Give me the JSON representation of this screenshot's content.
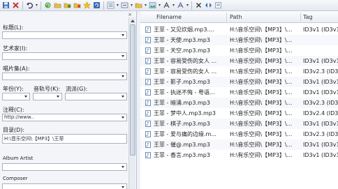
{
  "toolbar": {
    "icons": [
      "save-icon",
      "delete-icon",
      "undo-icon",
      "refresh-icon",
      "open-folder-icon",
      "folder-add-icon",
      "folder-star-icon",
      "star-icon",
      "reload-icon",
      "list-icon",
      "tag-convert-icon",
      "folder-icon",
      "image-icon",
      "text-format-icon",
      "font-icon",
      "close-icon",
      "flip-icon",
      "help-icon"
    ]
  },
  "left_panel": {
    "close": "×",
    "fields": {
      "title_label": "标题(L):",
      "artist_label": "艺术家(I):",
      "album_label": "唱片集(A):",
      "year_label": "年份(Y):",
      "track_label": "音轨号(K):",
      "genre_label": "流派(G):",
      "comment_label": "注释(C):",
      "comment_value": "http://www..",
      "directory_label": "目录(D):",
      "directory_value": "H:\\音乐空间\\【MP3】\\王菲",
      "album_artist_label": "Album Artist",
      "composer_label": "Composer"
    }
  },
  "file_list": {
    "columns": [
      "Filename",
      "Path",
      "Tag"
    ],
    "rows": [
      {
        "filename": "王菲 - 又见炊烟.mp3....",
        "path": "H:\\音乐空间\\【MP3】\\...",
        "tag": "ID3v1 (ID3v1"
      },
      {
        "filename": "王菲 - 天使.mp3.mp3",
        "path": "H:\\音乐空间\\【MP3】\\...",
        "tag": ""
      },
      {
        "filename": "王菲 - 天空.mp3.mp3",
        "path": "H:\\音乐空间\\【MP3】\\...",
        "tag": ""
      },
      {
        "filename": "王菲 - 容易受伤的女人 ...",
        "path": "H:\\音乐空间\\【MP3】\\...",
        "tag": "ID3v1 (ID3v1"
      },
      {
        "filename": "王菲 - 容易受伤的女人 ...",
        "path": "H:\\音乐空间\\【MP3】\\...",
        "tag": "ID3v2.3 (ID3"
      },
      {
        "filename": "王菲 - 影子.mp3.mp3",
        "path": "H:\\音乐空间\\【MP3】\\...",
        "tag": "ID3v1 (ID3v1"
      },
      {
        "filename": "王菲 - 执迷不悔 - 粤语...",
        "path": "H:\\音乐空间\\【MP3】\\...",
        "tag": "ID3v1 (ID3v1"
      },
      {
        "filename": "王菲 - 暗涌.mp3.mp3",
        "path": "H:\\音乐空间\\【MP3】\\...",
        "tag": "ID3v2.3 (ID3"
      },
      {
        "filename": "王菲 - 梦中人.mp3.mp3",
        "path": "H:\\音乐空间\\【MP3】\\...",
        "tag": "ID3v2.4 (ID3"
      },
      {
        "filename": "王菲 - 棋子.mp3.mp3",
        "path": "H:\\音乐空间\\【MP3】\\...",
        "tag": "ID3v1 (ID3v1"
      },
      {
        "filename": "王菲 - 爱与痛的边缘.m...",
        "path": "H:\\音乐空间\\【MP3】\\...",
        "tag": "ID3v2.3 (ID3"
      },
      {
        "filename": "王菲 - 催@.mp3.mp3",
        "path": "H:\\音乐空间\\【MP3】\\...",
        "tag": "ID3v1 (ID3v1"
      },
      {
        "filename": "王菲 - 香言.mp3.mp3",
        "path": "H:\\有乐空间\\【MP3】\\...",
        "tag": "ID3v1 (ID3v1"
      }
    ]
  },
  "colors": {
    "list_text": "#1a1a1a",
    "panel_bg": "#f3f5f9",
    "accent": "#2a58a0"
  }
}
